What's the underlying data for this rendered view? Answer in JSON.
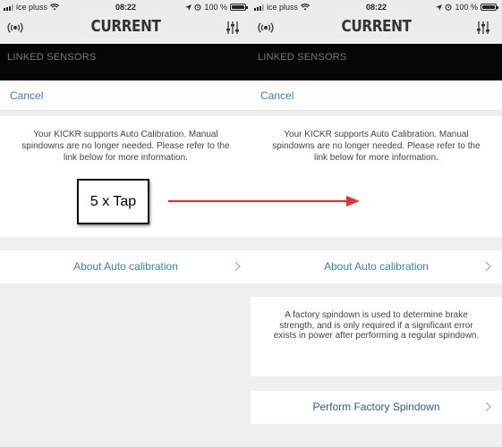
{
  "status_bar": {
    "carrier": "ice pluss",
    "time": "08:22",
    "battery": "100 %",
    "battery_level": 1.0
  },
  "header": {
    "logo": "CURRENT",
    "left_icon": "broadcast-icon",
    "right_icon": "sliders-icon"
  },
  "sensor_bar": {
    "title": "LINKED SENSORS"
  },
  "cancel_label": "Cancel",
  "info_text": "Your KICKR supports Auto Calibration. Manual spindowns are no longer needed. Please refer to the link below for more information.",
  "tap_annotation": "5 x Tap",
  "about_link": "About Auto calibration",
  "factory_text": "A factory spindown is used to determine brake strength, and is only required if a significant error exists in power after performing a regular spindown.",
  "perform_label": "Perform Factory Spindown",
  "colors": {
    "link": "#3a82b7",
    "arrow": "#d9363b",
    "sensor_bar": "#050505"
  }
}
